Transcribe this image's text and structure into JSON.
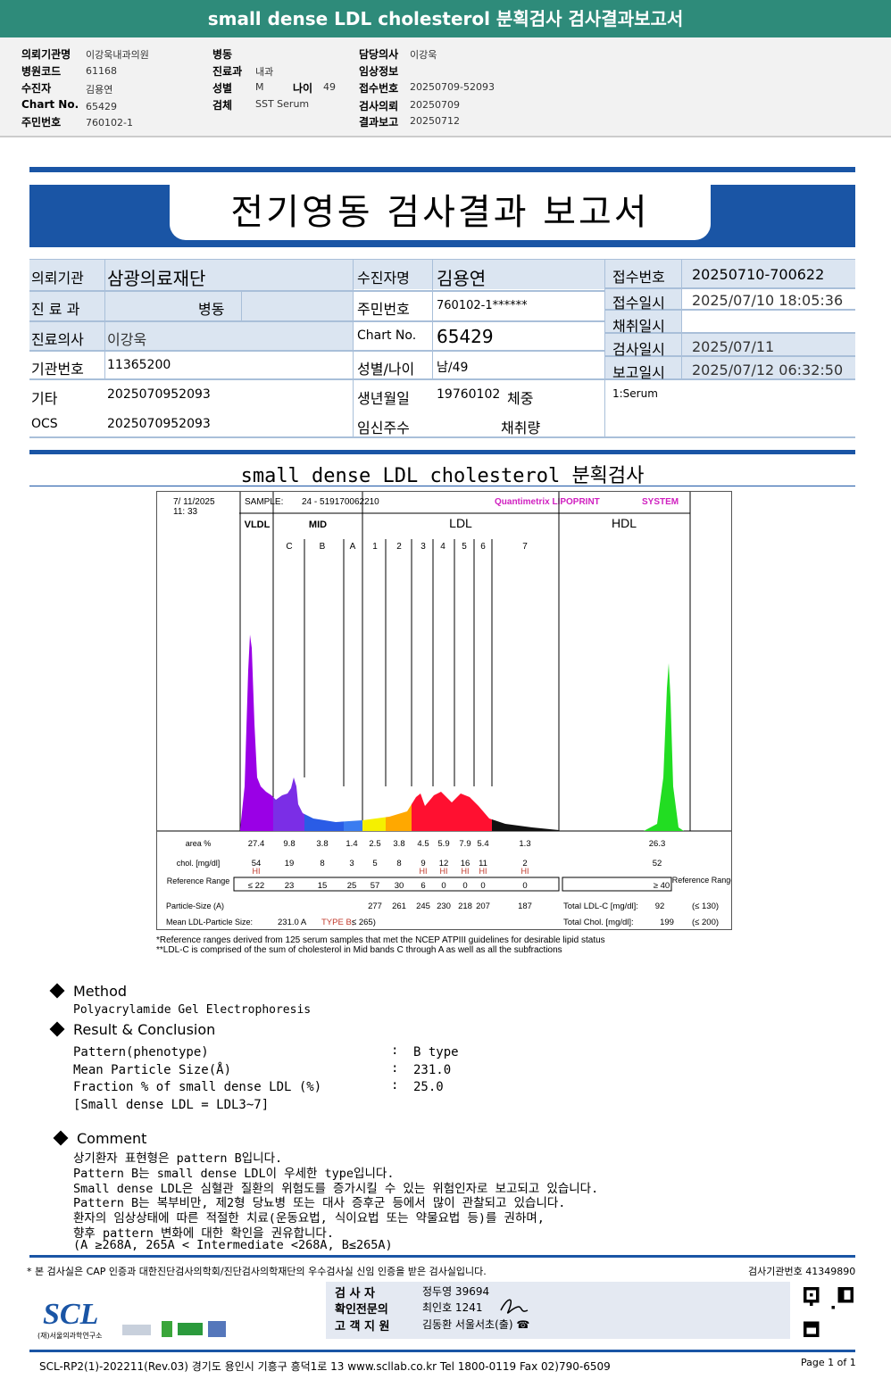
{
  "top_title": "small dense LDL cholesterol 분획검사 검사결과보고서",
  "summary": {
    "col1": [
      {
        "k": "의뢰기관명",
        "v": "이강욱내과의원"
      },
      {
        "k": "병원코드",
        "v": "61168"
      },
      {
        "k": "수진자",
        "v": "김용연"
      },
      {
        "k": "Chart No.",
        "v": "65429"
      },
      {
        "k": "주민번호",
        "v": "760102-1"
      }
    ],
    "col2": [
      {
        "k": "병동",
        "v": ""
      },
      {
        "k": "진료과",
        "v": "내과"
      },
      {
        "k": "성별",
        "v": "M"
      },
      {
        "k": "검체",
        "v": "SST Serum"
      }
    ],
    "age_label": "나이",
    "age": "49",
    "col3": [
      {
        "k": "담당의사",
        "v": "이강욱"
      },
      {
        "k": "임상정보",
        "v": ""
      },
      {
        "k": "접수번호",
        "v": "20250709-52093"
      },
      {
        "k": "검사의뢰",
        "v": "20250709"
      },
      {
        "k": "결과보고",
        "v": "20250712"
      }
    ]
  },
  "report_title": "전기영동 검사결과 보고서",
  "info": {
    "institution_label": "의뢰기관",
    "institution": "삼광의료재단",
    "dept_label": "진 료 과",
    "ward_label": "병동",
    "doctor_label": "진료의사",
    "doctor": "이강욱",
    "inst_no_label": "기관번호",
    "inst_no": "11365200",
    "etc_label": "기타",
    "etc": "2025070952093",
    "ocs_label": "OCS",
    "ocs": "2025070952093",
    "patient_label": "수진자명",
    "patient": "김용연",
    "rrn_label": "주민번호",
    "rrn": "760102-1******",
    "chart_label": "Chart No.",
    "chart": "65429",
    "sexage_label": "성별/나이",
    "sexage": "남/49",
    "birth_label": "생년월일",
    "birth": "19760102",
    "weight_label": "체중",
    "preg_label": "임신주수",
    "volume_label": "채취량",
    "receipt_no_label": "접수번호",
    "receipt_no": "20250710-700622",
    "receipt_dt_label": "접수일시",
    "receipt_dt": "2025/07/10 18:05:36",
    "collect_label": "채취일시",
    "collect": "",
    "test_dt_label": "검사일시",
    "test_dt": "2025/07/11",
    "report_dt_label": "보고일시",
    "report_dt": "2025/07/12 06:32:50",
    "specimen": "1:Serum"
  },
  "section_title": "small dense LDL cholesterol 분획검사",
  "lipoprint": {
    "date": "7/ 11/2025",
    "time": "11: 33",
    "sample_label": "SAMPLE:",
    "sample": "24 - 519170062210",
    "brand": "Quantimetrix LIPOPRINT",
    "brand_suffix": "SYSTEM",
    "groups": [
      "VLDL",
      "MID",
      "LDL",
      "HDL"
    ],
    "bands": [
      "C",
      "B",
      "A",
      "1",
      "2",
      "3",
      "4",
      "5",
      "6",
      "7"
    ],
    "colors": {
      "vldl": "#9a00e6",
      "midc": "#7b2ee6",
      "midb": "#2a5ce6",
      "mida": "#3b7cf0",
      "ldl1": "#f5f000",
      "ldl2": "#ffa800",
      "ldl3_6": "#ff1030",
      "ldl7": "#111111",
      "hdl": "#22dd22"
    },
    "row_labels": {
      "area": "area %",
      "chol": "chol. [mg/dl]",
      "ref": "Reference Range",
      "size": "Particle-Size (A)",
      "mean": "Mean LDL-Particle Size:"
    },
    "area": [
      "27.4",
      "9.8",
      "3.8",
      "1.4",
      "2.5",
      "3.8",
      "4.5",
      "5.9",
      "7.9",
      "5.4",
      "1.3",
      "26.3"
    ],
    "chol": [
      "54",
      "19",
      "8",
      "3",
      "5",
      "8",
      "9",
      "12",
      "16",
      "11",
      "2",
      "52"
    ],
    "hi": [
      "HI",
      "",
      "",
      "",
      "",
      "",
      "HI",
      "HI",
      "HI",
      "HI",
      "HI",
      ""
    ],
    "ref": [
      "≤ 22",
      "23",
      "15",
      "25",
      "57",
      "30",
      "6",
      "0",
      "0",
      "0",
      "0",
      "≥ 40"
    ],
    "size": [
      "",
      "",
      "",
      "",
      "277",
      "261",
      "245",
      "230",
      "218",
      "207",
      "187"
    ],
    "mean_size": "231.0 A",
    "mean_type": "TYPE B;",
    "mean_ref": "≤ 265)",
    "ref_label_right": "Reference Range",
    "total_ldl_label": "Total LDL-C [mg/dl]:",
    "total_ldl": "92",
    "total_ldl_ref": "(≤ 130)",
    "total_chol_label": "Total Chol. [mg/dl]:",
    "total_chol": "199",
    "total_chol_ref": "(≤ 200)",
    "note1": "*Reference ranges derived from 125 serum samples that met the NCEP ATPIII guidelines for desirable lipid status",
    "note2": "**LDL-C is comprised of the sum of cholesterol in Mid bands C through A as well as all the subfractions"
  },
  "method": {
    "title": "Method",
    "text": "Polyacrylamide Gel Electrophoresis"
  },
  "result": {
    "title": "Result & Conclusion",
    "rows": [
      {
        "k": "Pattern(phenotype)",
        "v": "B type"
      },
      {
        "k": "Mean Particle Size(Å)",
        "v": "231.0"
      },
      {
        "k": "Fraction % of small dense LDL (%)",
        "v": "25.0"
      }
    ],
    "note": "[Small dense LDL = LDL3~7]"
  },
  "comment": {
    "title": "Comment",
    "lines": [
      "상기환자 표현형은 pattern B입니다.",
      "Pattern B는 small dense LDL이 우세한 type입니다.",
      "Small dense LDL은 심혈관 질환의 위험도를 증가시킬 수 있는 위험인자로 보고되고 있습니다.",
      "Pattern B는 복부비만, 제2형 당뇨병 또는 대사 증후군 등에서 많이 관찰되고 있습니다.",
      "환자의 임상상태에 따른 적절한 치료(운동요법, 식이요법 또는 약물요법 등)를 권하며,",
      "향후 pattern 변화에 대한 확인을 권유합니다.",
      "(A ≥268A, 265A < Intermediate <268A, B≤265A)"
    ]
  },
  "footer": {
    "cert": "* 본 검사실은 CAP 인증과 대한진단검사의학회/진단검사의학재단의 우수검사실 신임 인증을 받은 검사실입니다.",
    "lab_no": "검사기관번호 41349890",
    "tester_label": "검 사 자",
    "tester": "정두영 39694",
    "confirm_label": "확인전문의",
    "confirm": "최인호 1241",
    "support_label": "고 객 지 원",
    "support": "김동환 서울서초(출) ☎",
    "logo": "SCL",
    "logo_sub": "(재)서울의과학연구소",
    "bottom": "SCL-RP2(1)-202211(Rev.03) 경기도 용인시 기흥구 흥덕1로 13  www.scllab.co.kr  Tel 1800-0119  Fax 02)790-6509",
    "page": "Page 1 of 1"
  }
}
